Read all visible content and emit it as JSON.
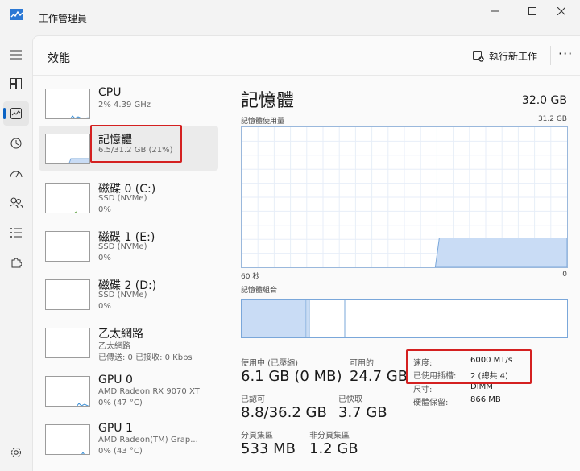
{
  "window": {
    "title": "工作管理員"
  },
  "header": {
    "page_title": "效能",
    "run_task_label": "執行新工作",
    "more_label": "···"
  },
  "devices": [
    {
      "name": "CPU",
      "line1": "2% 4.39 GHz",
      "line2": "",
      "line3": ""
    },
    {
      "name": "記憶體",
      "line1": "6.5/31.2 GB (21%)",
      "line2": "",
      "line3": ""
    },
    {
      "name": "磁碟 0 (C:)",
      "line1": "SSD (NVMe)",
      "line2": "0%",
      "line3": ""
    },
    {
      "name": "磁碟 1 (E:)",
      "line1": "SSD (NVMe)",
      "line2": "0%",
      "line3": ""
    },
    {
      "name": "磁碟 2 (D:)",
      "line1": "SSD (NVMe)",
      "line2": "0%",
      "line3": ""
    },
    {
      "name": "乙太網路",
      "line1": "乙太網路",
      "line2": "已傳送: 0 已接收: 0 Kbps",
      "line3": ""
    },
    {
      "name": "GPU 0",
      "line1": "AMD Radeon RX 9070 XT",
      "line2": "0% (47 °C)",
      "line3": ""
    },
    {
      "name": "GPU 1",
      "line1": "AMD Radeon(TM) Grap...",
      "line2": "0% (43 °C)",
      "line3": ""
    }
  ],
  "detail": {
    "title": "記憶體",
    "total": "32.0 GB",
    "usage_label": "記憶體使用量",
    "usage_max": "31.2 GB",
    "axis_left": "60 秒",
    "axis_right": "0",
    "composition_label": "記憶體組合",
    "graph_usage_fraction": 0.21,
    "stats": {
      "in_use_label": "使用中 (已壓縮)",
      "in_use_value": "6.1 GB (0 MB)",
      "available_label": "可用的",
      "available_value": "24.7 GB",
      "committed_label": "已認可",
      "committed_value": "8.8/36.2 GB",
      "cached_label": "已快取",
      "cached_value": "3.7 GB",
      "paged_label": "分頁集區",
      "paged_value": "533 MB",
      "nonpaged_label": "非分頁集區",
      "nonpaged_value": "1.2 GB"
    },
    "specs": [
      {
        "label": "速度:",
        "value": "6000 MT/s"
      },
      {
        "label": "已使用插槽:",
        "value": "2 (總共 4)"
      },
      {
        "label": "尺寸:",
        "value": "DIMM"
      },
      {
        "label": "硬體保留:",
        "value": "866 MB"
      }
    ]
  },
  "colors": {
    "accent": "#0b63c4",
    "graph_fill": "#c9dcf5",
    "graph_line": "#7aa7da",
    "highlight": "#d42020"
  }
}
